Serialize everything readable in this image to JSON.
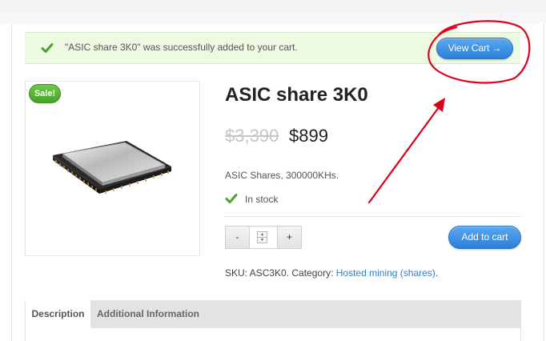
{
  "notice": {
    "message": "\"ASIC share 3K0\" was successfully added to your cart.",
    "view_cart_label": "View Cart",
    "view_cart_arrow": "→",
    "icon": "checkmark-icon"
  },
  "product": {
    "sale_badge": "Sale!",
    "title": "ASIC share 3K0",
    "old_price": "$3,390",
    "new_price": "$899",
    "description": "ASIC Shares, 300000KHs.",
    "stock": "In stock",
    "image_icon": "asic-chip-image"
  },
  "cart_form": {
    "minus_label": "-",
    "plus_label": "+",
    "add_to_cart_label": "Add to cart"
  },
  "meta": {
    "sku_prefix": "SKU: ASC3K0. Category:",
    "category": "Hosted mining (shares)",
    "suffix": "."
  },
  "tabs": [
    {
      "label": "Description",
      "active": true
    },
    {
      "label": "Additional Information",
      "active": false
    }
  ],
  "colors": {
    "accent_blue": "#2b7fd8",
    "sale_green": "#43a325",
    "notice_bg": "#eef9e2",
    "link": "#2f80c8",
    "annotation_red": "#e0001a"
  }
}
